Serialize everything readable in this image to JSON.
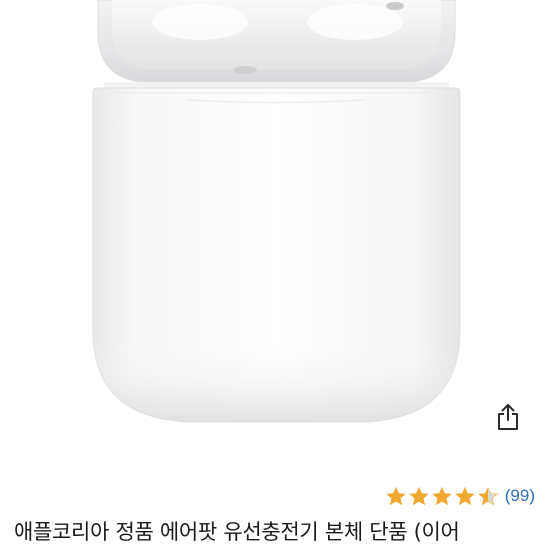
{
  "product": {
    "title": "애플코리아 정품 에어팟 유선충전기 본체 단품 (이어",
    "image_subject": "airpods-charging-case"
  },
  "rating": {
    "value_out_of_5": 4.5,
    "review_count": "(99)",
    "star_color": "#f0a830",
    "star_empty_color": "#d8d8d8"
  },
  "actions": {
    "share_icon": "share-icon"
  },
  "colors": {
    "link": "#2f6fb0",
    "text": "#1b1b1b"
  }
}
